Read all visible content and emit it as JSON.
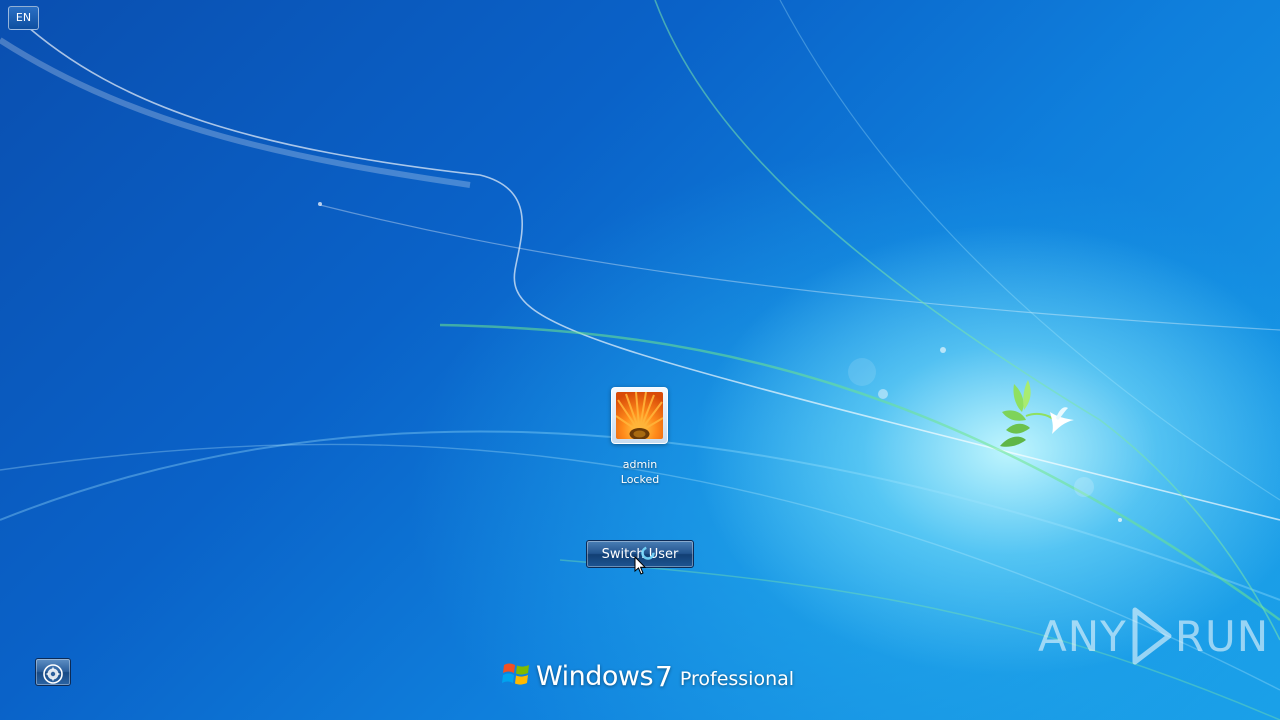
{
  "language_indicator": "EN",
  "user": {
    "name": "admin",
    "status": "Locked"
  },
  "buttons": {
    "switch_user_label": "Switch User"
  },
  "branding": {
    "name": "Windows",
    "version": "7",
    "edition": "Professional"
  },
  "watermark": {
    "left": "ANY",
    "right": "RUN"
  },
  "icons": {
    "ease_of_access": "ease-of-access-icon",
    "user_picture": "orange-flower-picture",
    "logo": "windows-flag-icon",
    "cursor": "busy-cursor-icon"
  },
  "colors": {
    "background_primary": "#0a62c8",
    "background_glow": "#c8faff",
    "button_face": "#23558f"
  }
}
